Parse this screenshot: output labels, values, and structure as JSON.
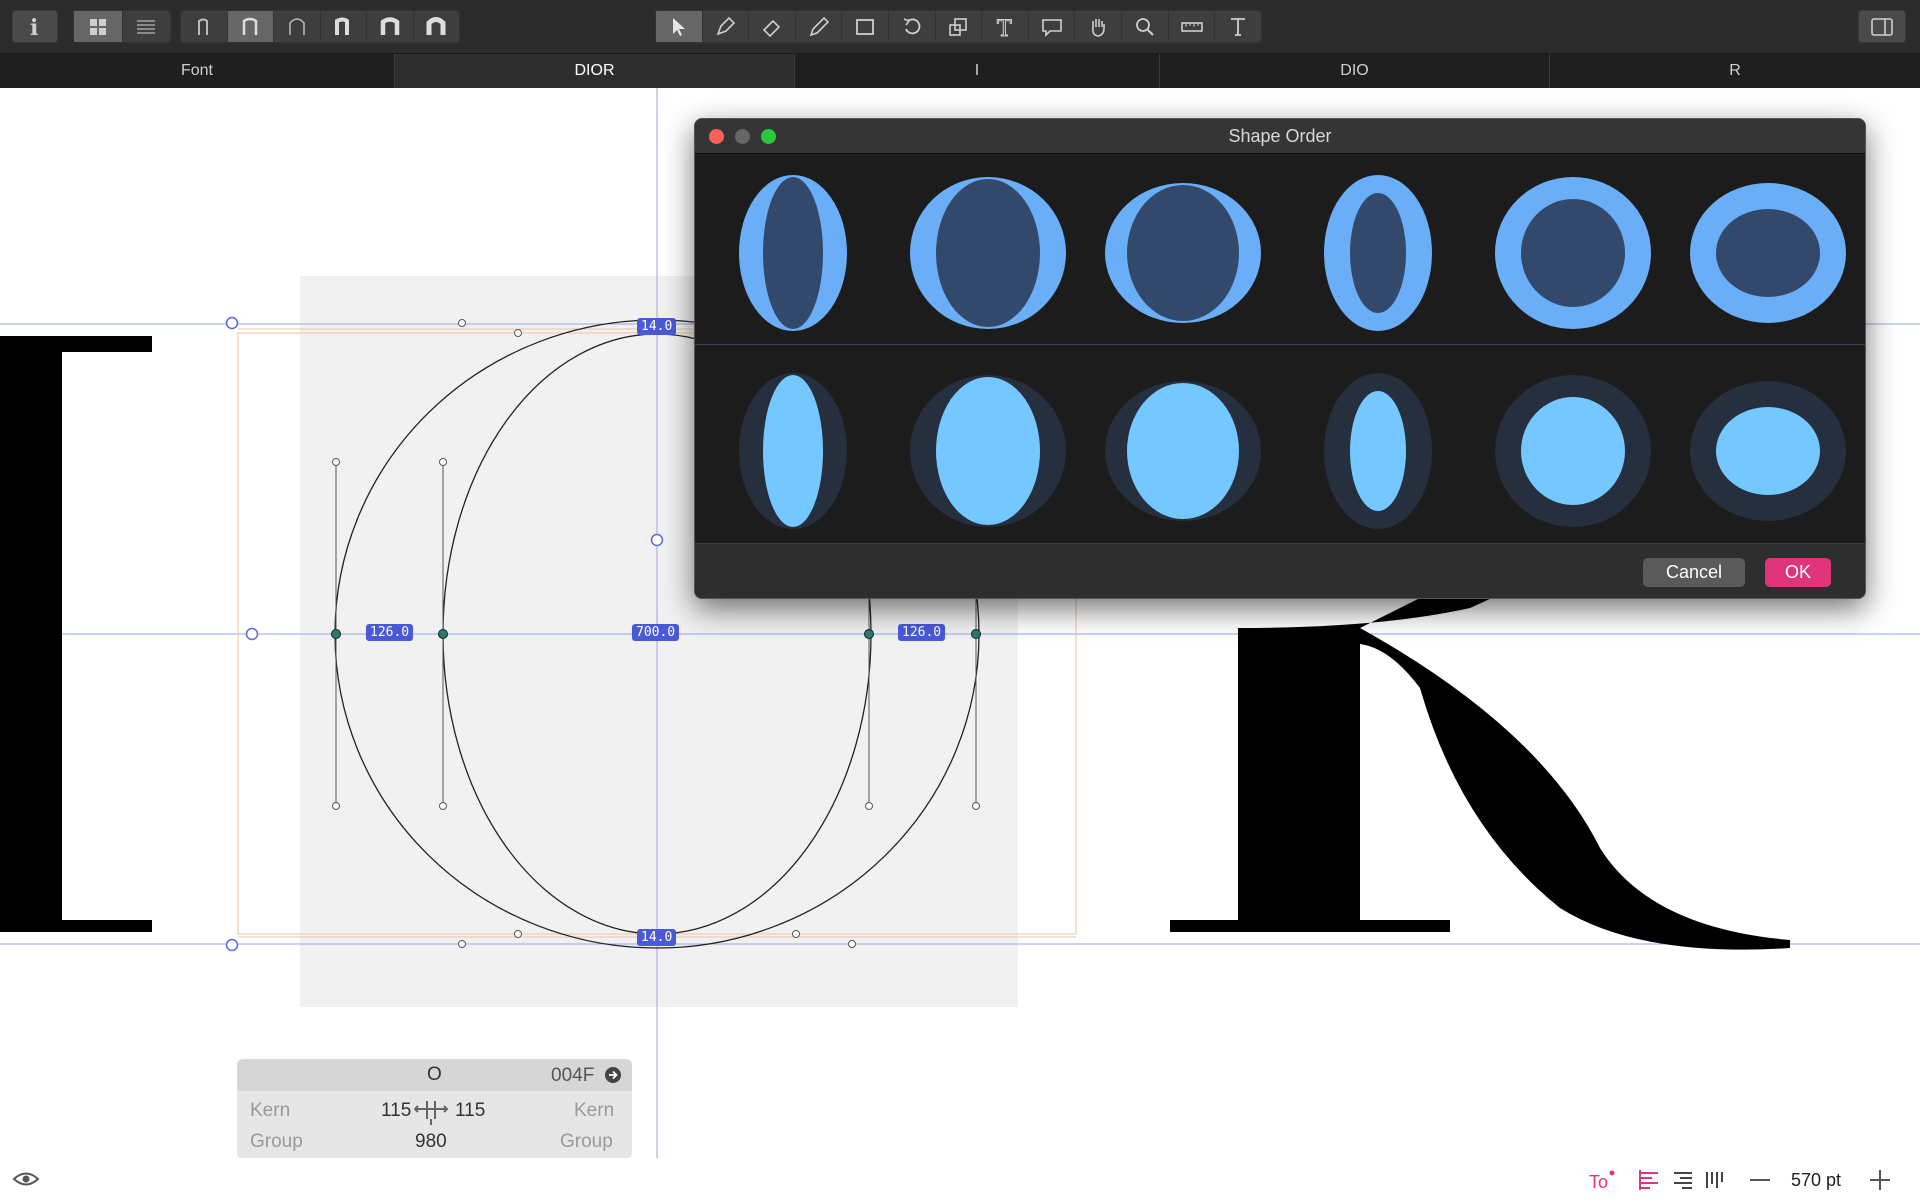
{
  "toolbar": {
    "tools": [
      "info-tool",
      "view-grid",
      "view-list",
      "glyph-1",
      "glyph-2",
      "glyph-3",
      "glyph-4",
      "glyph-5",
      "glyph-6",
      "pointer",
      "pen",
      "eraser",
      "pencil",
      "rectangle",
      "rotate",
      "scale",
      "text",
      "comment",
      "hand",
      "zoom",
      "ruler",
      "type-tool",
      "sidebar-toggle"
    ]
  },
  "tabs": [
    {
      "label": "Font",
      "active": false
    },
    {
      "label": "DIOR",
      "active": true
    },
    {
      "label": "I",
      "active": false
    },
    {
      "label": "DIO",
      "active": false
    },
    {
      "label": "R",
      "active": false
    }
  ],
  "canvas": {
    "measure_top": "14.0",
    "measure_bottom": "14.0",
    "measure_left": "126.0",
    "measure_center": "700.0",
    "measure_right": "126.0",
    "glyph_left": "I",
    "glyph_right": "R"
  },
  "glyph_info": {
    "name": "O",
    "unicode": "004F",
    "kern_label": "Kern",
    "left_kern": "115",
    "right_kern": "115",
    "group_label": "Group",
    "width": "980"
  },
  "dialog": {
    "title": "Shape Order",
    "cancel": "Cancel",
    "ok": "OK"
  },
  "status": {
    "zoom": "570 pt"
  },
  "colors": {
    "accent_pink": "#e0357a",
    "shape_blue": "#6aaef7",
    "shape_fill": "#33496b",
    "counter_blue": "#74c8ff",
    "counter_dark": "#252f3e",
    "dim_label": "#4a5ad6"
  }
}
